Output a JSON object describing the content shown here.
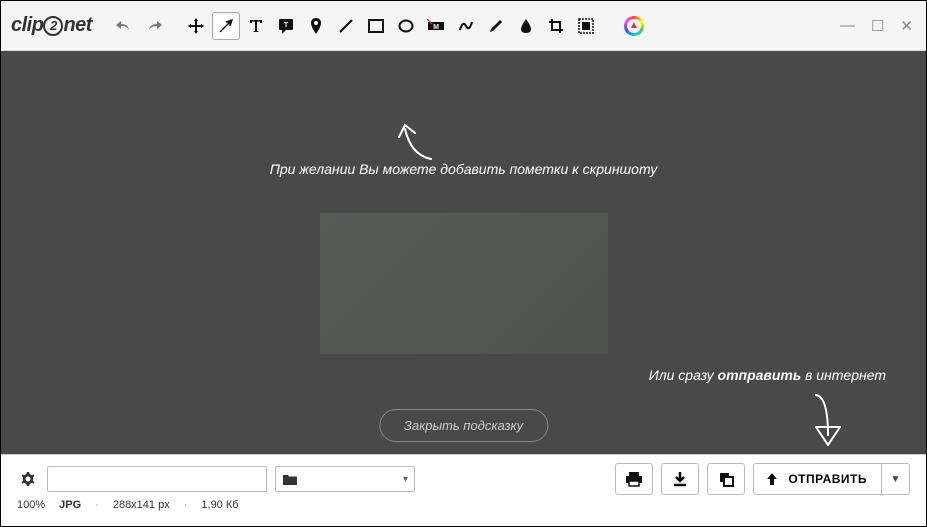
{
  "app_name": "clip2net",
  "logo": {
    "part1": "clip",
    "circle": "2",
    "part2": "net"
  },
  "hints": {
    "top": "При желании Вы можете добавить пометки к скриншоту",
    "right_prefix": "Или сразу ",
    "right_bold": "отправить",
    "right_suffix": " в интернет",
    "close": "Закрыть подсказку"
  },
  "bottom": {
    "zoom": "100%",
    "format": "JPG",
    "dimensions": "288x141 px",
    "filesize": "1,90 Кб",
    "send_label": "ОТПРАВИТЬ"
  },
  "tools": {
    "undo": "undo",
    "redo": "redo",
    "move": "move",
    "arrow": "arrow",
    "text": "text",
    "note": "note",
    "pin": "pin",
    "line": "line",
    "rect": "rect",
    "ellipse": "ellipse",
    "highlight": "highlight",
    "curve": "curve",
    "pencil": "pencil",
    "drop": "drop",
    "crop": "crop",
    "resize": "resize",
    "upload": "upload"
  }
}
